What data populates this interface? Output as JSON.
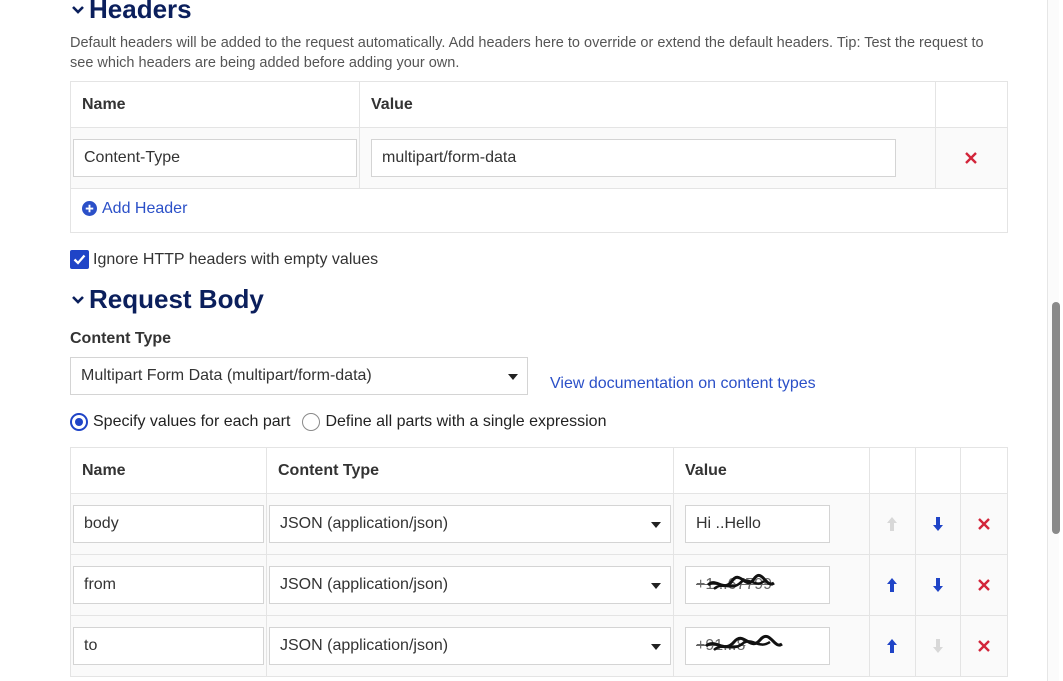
{
  "headers_section": {
    "title": "Headers",
    "help": "Default headers will be added to the request automatically. Add headers here to override or extend the default headers. Tip: Test the request to see which headers are being added before adding your own.",
    "columns": [
      "Name",
      "Value"
    ],
    "rows": [
      {
        "name": "Content-Type",
        "value": "multipart/form-data"
      }
    ],
    "add_label": "Add Header",
    "ignore_empty_label": "Ignore HTTP headers with empty values",
    "ignore_empty_checked": true
  },
  "body_section": {
    "title": "Request Body",
    "content_type_label": "Content Type",
    "content_type_value": "Multipart Form Data (multipart/form-data)",
    "docs_link": "View documentation on content types",
    "radio_specify": "Specify values for each part",
    "radio_single": "Define all parts with a single expression",
    "selected_radio": "specify",
    "columns": [
      "Name",
      "Content Type",
      "Value"
    ],
    "parts": [
      {
        "name": "body",
        "content_type": "JSON (application/json)",
        "value": "Hi ..Hello",
        "up_enabled": false,
        "down_enabled": true
      },
      {
        "name": "from",
        "content_type": "JSON (application/json)",
        "value": "+1...67799",
        "up_enabled": true,
        "down_enabled": true
      },
      {
        "name": "to",
        "content_type": "JSON (application/json)",
        "value": "+91...8",
        "up_enabled": true,
        "down_enabled": false
      }
    ]
  },
  "colors": {
    "title": "#0b1f5c",
    "accent": "#1f44c7",
    "link": "#2b50c8",
    "delete": "#d2253a",
    "arrow_enabled": "#1f44c7",
    "arrow_disabled": "#d8d8d8"
  }
}
